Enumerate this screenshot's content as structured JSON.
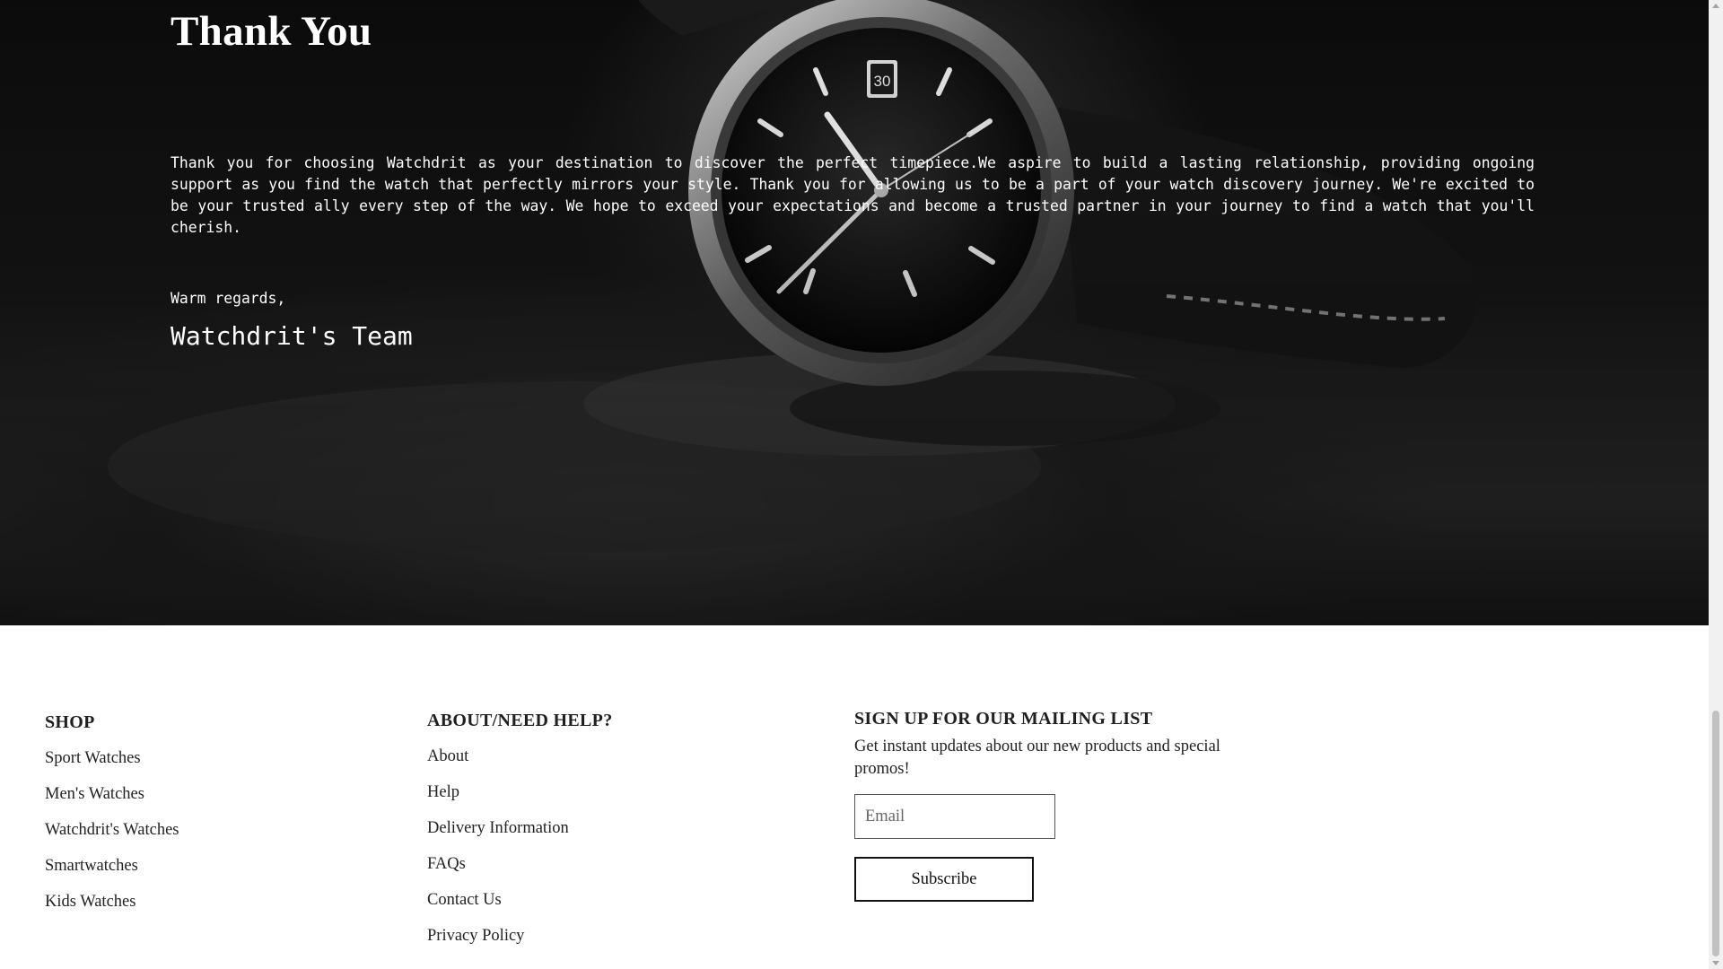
{
  "hero": {
    "title": "Thank You",
    "message": "Thank you for choosing Watchdrit as your destination to discover the perfect timepiece.We aspire to build a lasting relationship, providing ongoing support as you find the watch that perfectly mirrors your style. Thank you for allowing us to be a part of your watch discovery journey. We're excited to be your trusted ally every step of the way. We hope to exceed your expectations and become a trusted partner in your journey to find a watch that you'll cherish.",
    "regards": "Warm regards,",
    "signature": "Watchdrit's Team",
    "image_label": "wristwatch-photo",
    "watch_date": "30"
  },
  "footer": {
    "shop": {
      "title": "SHOP",
      "links": [
        "Sport Watches",
        "Men's Watches",
        "Watchdrit's Watches",
        "Smartwatches",
        "Kids Watches"
      ]
    },
    "about": {
      "title": "ABOUT/NEED HELP?",
      "links": [
        "About",
        "Help",
        "Delivery Information",
        "FAQs",
        "Contact Us",
        "Privacy Policy"
      ]
    },
    "mailing": {
      "title": "SIGN UP FOR OUR MAILING LIST",
      "text": "Get instant updates about our new products and special promos!",
      "email_placeholder": "Email",
      "subscribe_label": "Subscribe"
    }
  },
  "colors": {
    "hero_background": "#1a1a1a",
    "hero_text": "#ffffff",
    "footer_text": "#222222",
    "button_border": "#111111"
  }
}
